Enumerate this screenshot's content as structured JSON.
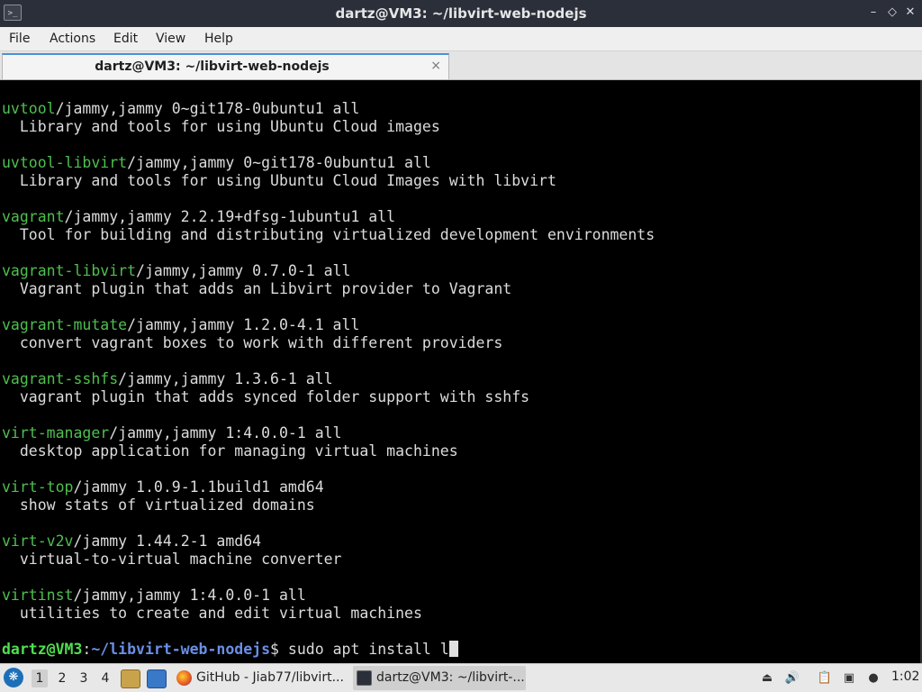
{
  "window": {
    "title": "dartz@VM3: ~/libvirt-web-nodejs",
    "app_icon": "terminal-icon",
    "controls": [
      "minimize-icon",
      "maximize-icon",
      "close-icon"
    ]
  },
  "menubar": {
    "items": [
      "File",
      "Actions",
      "Edit",
      "View",
      "Help"
    ]
  },
  "tabs": [
    {
      "label": "dartz@VM3: ~/libvirt-web-nodejs",
      "close_glyph": "×"
    }
  ],
  "terminal": {
    "lines": [
      {
        "pkg": "uvtool",
        "rest": "/jammy,jammy 0~git178-0ubuntu1 all"
      },
      {
        "text": "  Library and tools for using Ubuntu Cloud images"
      },
      {
        "text": ""
      },
      {
        "pkg": "uvtool-libvirt",
        "rest": "/jammy,jammy 0~git178-0ubuntu1 all"
      },
      {
        "text": "  Library and tools for using Ubuntu Cloud Images with libvirt"
      },
      {
        "text": ""
      },
      {
        "pkg": "vagrant",
        "rest": "/jammy,jammy 2.2.19+dfsg-1ubuntu1 all"
      },
      {
        "text": "  Tool for building and distributing virtualized development environments"
      },
      {
        "text": ""
      },
      {
        "pkg": "vagrant-libvirt",
        "rest": "/jammy,jammy 0.7.0-1 all"
      },
      {
        "text": "  Vagrant plugin that adds an Libvirt provider to Vagrant"
      },
      {
        "text": ""
      },
      {
        "pkg": "vagrant-mutate",
        "rest": "/jammy,jammy 1.2.0-4.1 all"
      },
      {
        "text": "  convert vagrant boxes to work with different providers"
      },
      {
        "text": ""
      },
      {
        "pkg": "vagrant-sshfs",
        "rest": "/jammy,jammy 1.3.6-1 all"
      },
      {
        "text": "  vagrant plugin that adds synced folder support with sshfs"
      },
      {
        "text": ""
      },
      {
        "pkg": "virt-manager",
        "rest": "/jammy,jammy 1:4.0.0-1 all"
      },
      {
        "text": "  desktop application for managing virtual machines"
      },
      {
        "text": ""
      },
      {
        "pkg": "virt-top",
        "rest": "/jammy 1.0.9-1.1build1 amd64"
      },
      {
        "text": "  show stats of virtualized domains"
      },
      {
        "text": ""
      },
      {
        "pkg": "virt-v2v",
        "rest": "/jammy 1.44.2-1 amd64"
      },
      {
        "text": "  virtual-to-virtual machine converter"
      },
      {
        "text": ""
      },
      {
        "pkg": "virtinst",
        "rest": "/jammy,jammy 1:4.0.0-1 all"
      },
      {
        "text": "  utilities to create and edit virtual machines"
      },
      {
        "text": ""
      }
    ],
    "prompt": {
      "user_host": "dartz@VM3",
      "separator": ":",
      "path": "~/libvirt-web-nodejs",
      "symbol": "$",
      "command": " sudo apt install l"
    },
    "colors": {
      "package": "#4fbf4f",
      "prompt_user": "#4fdf4f",
      "prompt_path": "#6a8fe6",
      "text": "#dcdcdc",
      "background": "#000000"
    }
  },
  "taskbar": {
    "start_icon": "lxqt-menu-icon",
    "workspaces": [
      "1",
      "2",
      "3",
      "4"
    ],
    "active_workspace": "1",
    "quicklaunch": [
      "file-manager-icon",
      "show-desktop-icon"
    ],
    "tasks": [
      {
        "label": "GitHub - Jiab77/libvirt...",
        "icon": "firefox-icon"
      },
      {
        "label": "dartz@VM3: ~/libvirt-...",
        "icon": "terminal-icon",
        "active": true
      }
    ],
    "tray": [
      "removable-media-icon",
      "volume-icon",
      "clipboard-icon",
      "network-icon",
      "notifications-icon"
    ],
    "clock": "1:02"
  }
}
